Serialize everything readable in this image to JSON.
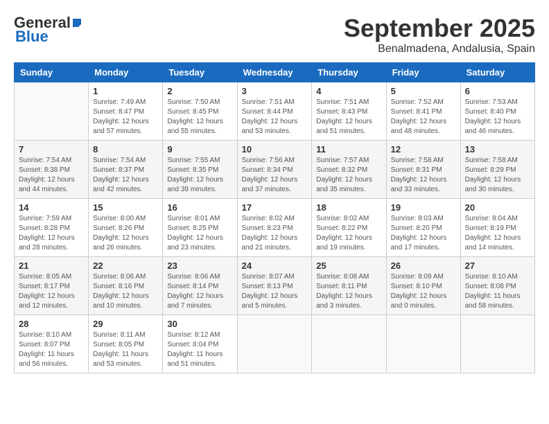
{
  "logo": {
    "general": "General",
    "blue": "Blue"
  },
  "title": "September 2025",
  "subtitle": "Benalmadena, Andalusia, Spain",
  "days_of_week": [
    "Sunday",
    "Monday",
    "Tuesday",
    "Wednesday",
    "Thursday",
    "Friday",
    "Saturday"
  ],
  "weeks": [
    [
      {
        "day": "",
        "detail": ""
      },
      {
        "day": "1",
        "detail": "Sunrise: 7:49 AM\nSunset: 8:47 PM\nDaylight: 12 hours\nand 57 minutes."
      },
      {
        "day": "2",
        "detail": "Sunrise: 7:50 AM\nSunset: 8:45 PM\nDaylight: 12 hours\nand 55 minutes."
      },
      {
        "day": "3",
        "detail": "Sunrise: 7:51 AM\nSunset: 8:44 PM\nDaylight: 12 hours\nand 53 minutes."
      },
      {
        "day": "4",
        "detail": "Sunrise: 7:51 AM\nSunset: 8:43 PM\nDaylight: 12 hours\nand 51 minutes."
      },
      {
        "day": "5",
        "detail": "Sunrise: 7:52 AM\nSunset: 8:41 PM\nDaylight: 12 hours\nand 48 minutes."
      },
      {
        "day": "6",
        "detail": "Sunrise: 7:53 AM\nSunset: 8:40 PM\nDaylight: 12 hours\nand 46 minutes."
      }
    ],
    [
      {
        "day": "7",
        "detail": "Sunrise: 7:54 AM\nSunset: 8:38 PM\nDaylight: 12 hours\nand 44 minutes."
      },
      {
        "day": "8",
        "detail": "Sunrise: 7:54 AM\nSunset: 8:37 PM\nDaylight: 12 hours\nand 42 minutes."
      },
      {
        "day": "9",
        "detail": "Sunrise: 7:55 AM\nSunset: 8:35 PM\nDaylight: 12 hours\nand 39 minutes."
      },
      {
        "day": "10",
        "detail": "Sunrise: 7:56 AM\nSunset: 8:34 PM\nDaylight: 12 hours\nand 37 minutes."
      },
      {
        "day": "11",
        "detail": "Sunrise: 7:57 AM\nSunset: 8:32 PM\nDaylight: 12 hours\nand 35 minutes."
      },
      {
        "day": "12",
        "detail": "Sunrise: 7:58 AM\nSunset: 8:31 PM\nDaylight: 12 hours\nand 33 minutes."
      },
      {
        "day": "13",
        "detail": "Sunrise: 7:58 AM\nSunset: 8:29 PM\nDaylight: 12 hours\nand 30 minutes."
      }
    ],
    [
      {
        "day": "14",
        "detail": "Sunrise: 7:59 AM\nSunset: 8:28 PM\nDaylight: 12 hours\nand 28 minutes."
      },
      {
        "day": "15",
        "detail": "Sunrise: 8:00 AM\nSunset: 8:26 PM\nDaylight: 12 hours\nand 26 minutes."
      },
      {
        "day": "16",
        "detail": "Sunrise: 8:01 AM\nSunset: 8:25 PM\nDaylight: 12 hours\nand 23 minutes."
      },
      {
        "day": "17",
        "detail": "Sunrise: 8:02 AM\nSunset: 8:23 PM\nDaylight: 12 hours\nand 21 minutes."
      },
      {
        "day": "18",
        "detail": "Sunrise: 8:02 AM\nSunset: 8:22 PM\nDaylight: 12 hours\nand 19 minutes."
      },
      {
        "day": "19",
        "detail": "Sunrise: 8:03 AM\nSunset: 8:20 PM\nDaylight: 12 hours\nand 17 minutes."
      },
      {
        "day": "20",
        "detail": "Sunrise: 8:04 AM\nSunset: 8:19 PM\nDaylight: 12 hours\nand 14 minutes."
      }
    ],
    [
      {
        "day": "21",
        "detail": "Sunrise: 8:05 AM\nSunset: 8:17 PM\nDaylight: 12 hours\nand 12 minutes."
      },
      {
        "day": "22",
        "detail": "Sunrise: 8:06 AM\nSunset: 8:16 PM\nDaylight: 12 hours\nand 10 minutes."
      },
      {
        "day": "23",
        "detail": "Sunrise: 8:06 AM\nSunset: 8:14 PM\nDaylight: 12 hours\nand 7 minutes."
      },
      {
        "day": "24",
        "detail": "Sunrise: 8:07 AM\nSunset: 8:13 PM\nDaylight: 12 hours\nand 5 minutes."
      },
      {
        "day": "25",
        "detail": "Sunrise: 8:08 AM\nSunset: 8:11 PM\nDaylight: 12 hours\nand 3 minutes."
      },
      {
        "day": "26",
        "detail": "Sunrise: 8:09 AM\nSunset: 8:10 PM\nDaylight: 12 hours\nand 0 minutes."
      },
      {
        "day": "27",
        "detail": "Sunrise: 8:10 AM\nSunset: 8:08 PM\nDaylight: 11 hours\nand 58 minutes."
      }
    ],
    [
      {
        "day": "28",
        "detail": "Sunrise: 8:10 AM\nSunset: 8:07 PM\nDaylight: 11 hours\nand 56 minutes."
      },
      {
        "day": "29",
        "detail": "Sunrise: 8:11 AM\nSunset: 8:05 PM\nDaylight: 11 hours\nand 53 minutes."
      },
      {
        "day": "30",
        "detail": "Sunrise: 8:12 AM\nSunset: 8:04 PM\nDaylight: 11 hours\nand 51 minutes."
      },
      {
        "day": "",
        "detail": ""
      },
      {
        "day": "",
        "detail": ""
      },
      {
        "day": "",
        "detail": ""
      },
      {
        "day": "",
        "detail": ""
      }
    ]
  ]
}
